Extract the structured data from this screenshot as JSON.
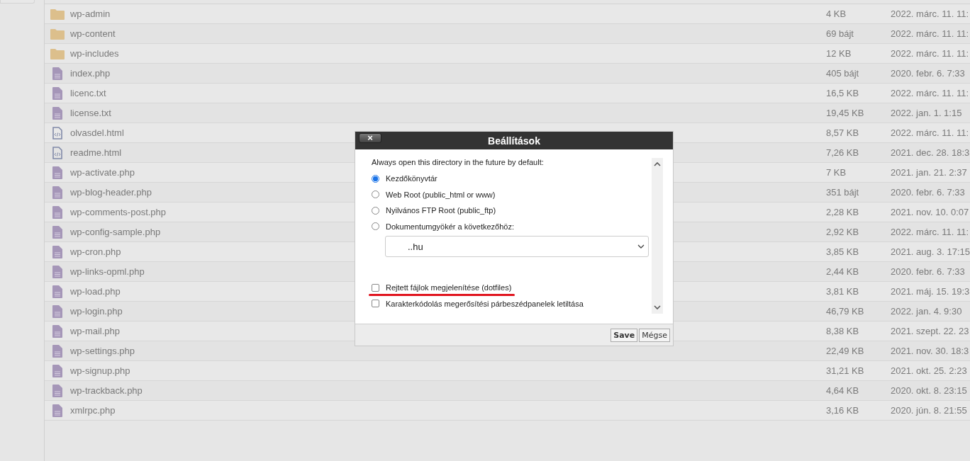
{
  "files": [
    {
      "kind": "folder",
      "name": "wp-admin",
      "size": "4 KB",
      "date": "2022. márc. 11. 11:"
    },
    {
      "kind": "folder",
      "name": "wp-content",
      "size": "69 bájt",
      "date": "2022. márc. 11. 11:"
    },
    {
      "kind": "folder",
      "name": "wp-includes",
      "size": "12 KB",
      "date": "2022. márc. 11. 11:"
    },
    {
      "kind": "file",
      "name": "index.php",
      "size": "405 bájt",
      "date": "2020. febr. 6. 7:33"
    },
    {
      "kind": "file",
      "name": "licenc.txt",
      "size": "16,5 KB",
      "date": "2022. márc. 11. 11:"
    },
    {
      "kind": "file",
      "name": "license.txt",
      "size": "19,45 KB",
      "date": "2022. jan. 1. 1:15"
    },
    {
      "kind": "html",
      "name": "olvasdel.html",
      "size": "8,57 KB",
      "date": "2022. márc. 11. 11:"
    },
    {
      "kind": "html",
      "name": "readme.html",
      "size": "7,26 KB",
      "date": "2021. dec. 28. 18:3"
    },
    {
      "kind": "file",
      "name": "wp-activate.php",
      "size": "7 KB",
      "date": "2021. jan. 21. 2:37"
    },
    {
      "kind": "file",
      "name": "wp-blog-header.php",
      "size": "351 bájt",
      "date": "2020. febr. 6. 7:33"
    },
    {
      "kind": "file",
      "name": "wp-comments-post.php",
      "size": "2,28 KB",
      "date": "2021. nov. 10. 0:07"
    },
    {
      "kind": "file",
      "name": "wp-config-sample.php",
      "size": "2,92 KB",
      "date": "2022. márc. 11. 11:"
    },
    {
      "kind": "file",
      "name": "wp-cron.php",
      "size": "3,85 KB",
      "date": "2021. aug. 3. 17:15"
    },
    {
      "kind": "file",
      "name": "wp-links-opml.php",
      "size": "2,44 KB",
      "date": "2020. febr. 6. 7:33"
    },
    {
      "kind": "file",
      "name": "wp-load.php",
      "size": "3,81 KB",
      "date": "2021. máj. 15. 19:3"
    },
    {
      "kind": "file",
      "name": "wp-login.php",
      "size": "46,79 KB",
      "date": "2022. jan. 4. 9:30"
    },
    {
      "kind": "file",
      "name": "wp-mail.php",
      "size": "8,38 KB",
      "date": "2021. szept. 22. 23"
    },
    {
      "kind": "file",
      "name": "wp-settings.php",
      "size": "22,49 KB",
      "date": "2021. nov. 30. 18:3"
    },
    {
      "kind": "file",
      "name": "wp-signup.php",
      "size": "31,21 KB",
      "date": "2021. okt. 25. 2:23"
    },
    {
      "kind": "file",
      "name": "wp-trackback.php",
      "size": "4,64 KB",
      "date": "2020. okt. 8. 23:15"
    },
    {
      "kind": "file",
      "name": "xmlrpc.php",
      "size": "3,16 KB",
      "date": "2020. jún. 8. 21:55"
    }
  ],
  "dialog": {
    "title": "Beállítások",
    "close": "×",
    "intro": "Always open this directory in the future by default:",
    "radios": [
      {
        "label": "Kezdőkönyvtár",
        "selected": true
      },
      {
        "label": "Web Root (public_html or www)",
        "selected": false
      },
      {
        "label": "Nyilvános FTP Root (public_ftp)",
        "selected": false
      },
      {
        "label": "Dokumentumgyökér a következőhöz:",
        "selected": false
      }
    ],
    "select": {
      "value": "..hu"
    },
    "checkboxes": [
      {
        "label": "Rejtett fájlok megjelenítése (dotfiles)",
        "checked": false,
        "underlined": true
      },
      {
        "label": "Karakterkódolás megerősítési párbeszédpanelek letiltása",
        "checked": false
      }
    ],
    "buttons": [
      "Save",
      "Mégse"
    ]
  }
}
